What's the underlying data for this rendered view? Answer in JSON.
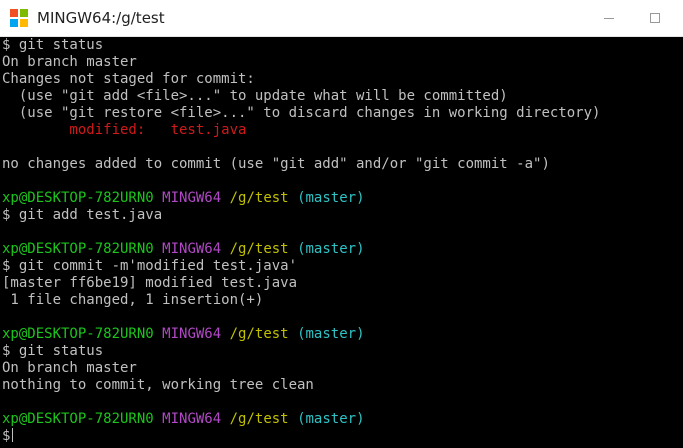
{
  "window": {
    "title": "MINGW64:/g/test",
    "icon": "git-bash-icon",
    "controls": [
      "minimize",
      "maximize",
      "close"
    ]
  },
  "colors": {
    "background": "#000000",
    "text": "#c0c0c0",
    "user_host": "#1cc41c",
    "mingw": "#b148c6",
    "path": "#c0c000",
    "branch": "#2fc2c3",
    "modified": "#d01a1a"
  },
  "prompt": {
    "user_host": "xp@DESKTOP-782URN0",
    "env": "MINGW64",
    "path": "/g/test",
    "branch": "(master)",
    "symbol": "$"
  },
  "terminal": {
    "l1": "$ git status",
    "l2": "On branch master",
    "l3": "Changes not staged for commit:",
    "l4": "  (use \"git add <file>...\" to update what will be committed)",
    "l5": "  (use \"git restore <file>...\" to discard changes in working directory)",
    "l6_label": "        modified:   ",
    "l6_file": "test.java",
    "l8": "no changes added to commit (use \"git add\" and/or \"git commit -a\")",
    "l11": "$ git add test.java",
    "l14": "$ git commit -m'modified test.java'",
    "l15": "[master ff6be19] modified test.java",
    "l16": " 1 file changed, 1 insertion(+)",
    "l19": "$ git status",
    "l20": "On branch master",
    "l21": "nothing to commit, working tree clean",
    "l24": "$"
  }
}
